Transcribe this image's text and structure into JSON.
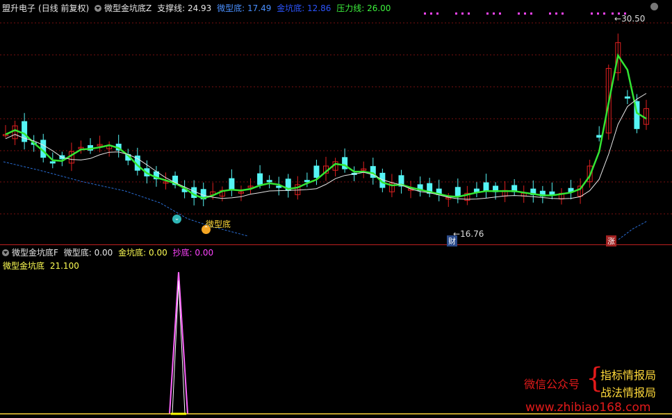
{
  "header": {
    "stock": "盟升电子",
    "period": "(日线 前复权)",
    "indicator_z": "微型金坑底Z",
    "support_label": "支撑线: 24.93",
    "micro_bottom_label": "微型底: 17.49",
    "gold_pit_label": "金坑底: 12.86",
    "pressure_label": "压力线: 26.00"
  },
  "sub_header": {
    "indicator_f": "微型金坑底F",
    "micro_bottom": "微型底: 0.00",
    "gold_pit": "金坑底: 0.00",
    "chaodi": "抄底: 0.00",
    "sub_title": "微型金坑底",
    "sub_value": "21.100"
  },
  "annotations": {
    "high": "30.50",
    "low": "16.76",
    "cai": "财",
    "zhang": "涨",
    "micro_bottom_text": "微型底"
  },
  "watermark": {
    "wechat": "微信公众号",
    "line1": "指标情报局",
    "line2": "战法情报局",
    "url": "www.zhibiao168.com"
  },
  "colors": {
    "up": "#e02020",
    "down": "#55f5f5",
    "ma_green": "#33e533",
    "ma_white": "#e8e8e8",
    "dash_blue": "#2a6ed6",
    "magenta": "#ff44ff",
    "grid": "#7a1010"
  },
  "chart_data": {
    "type": "candlestick",
    "close": [
      22.6,
      23.2,
      22.1,
      21.9,
      21.0,
      20.6,
      20.9,
      21.4,
      21.7,
      21.5,
      21.9,
      21.8,
      21.5,
      20.8,
      20.1,
      19.7,
      19.5,
      19.3,
      19.1,
      18.6,
      18.2,
      18.1,
      18.6,
      18.7,
      18.8,
      18.6,
      19.0,
      19.1,
      19.3,
      18.9,
      18.7,
      19.1,
      19.3,
      19.6,
      20.4,
      20.7,
      20.2,
      19.8,
      20.2,
      19.6,
      18.9,
      19.2,
      19.0,
      18.8,
      18.7,
      18.5,
      18.4,
      18.2,
      18.3,
      18.5,
      18.6,
      18.7,
      18.6,
      18.7,
      18.6,
      18.5,
      18.4,
      18.3,
      18.4,
      18.5,
      18.6,
      19.0,
      20.4,
      22.4,
      27.2,
      29.0,
      25.2,
      23.0,
      24.4
    ],
    "low_value": 16.76,
    "high_value": 30.5
  }
}
